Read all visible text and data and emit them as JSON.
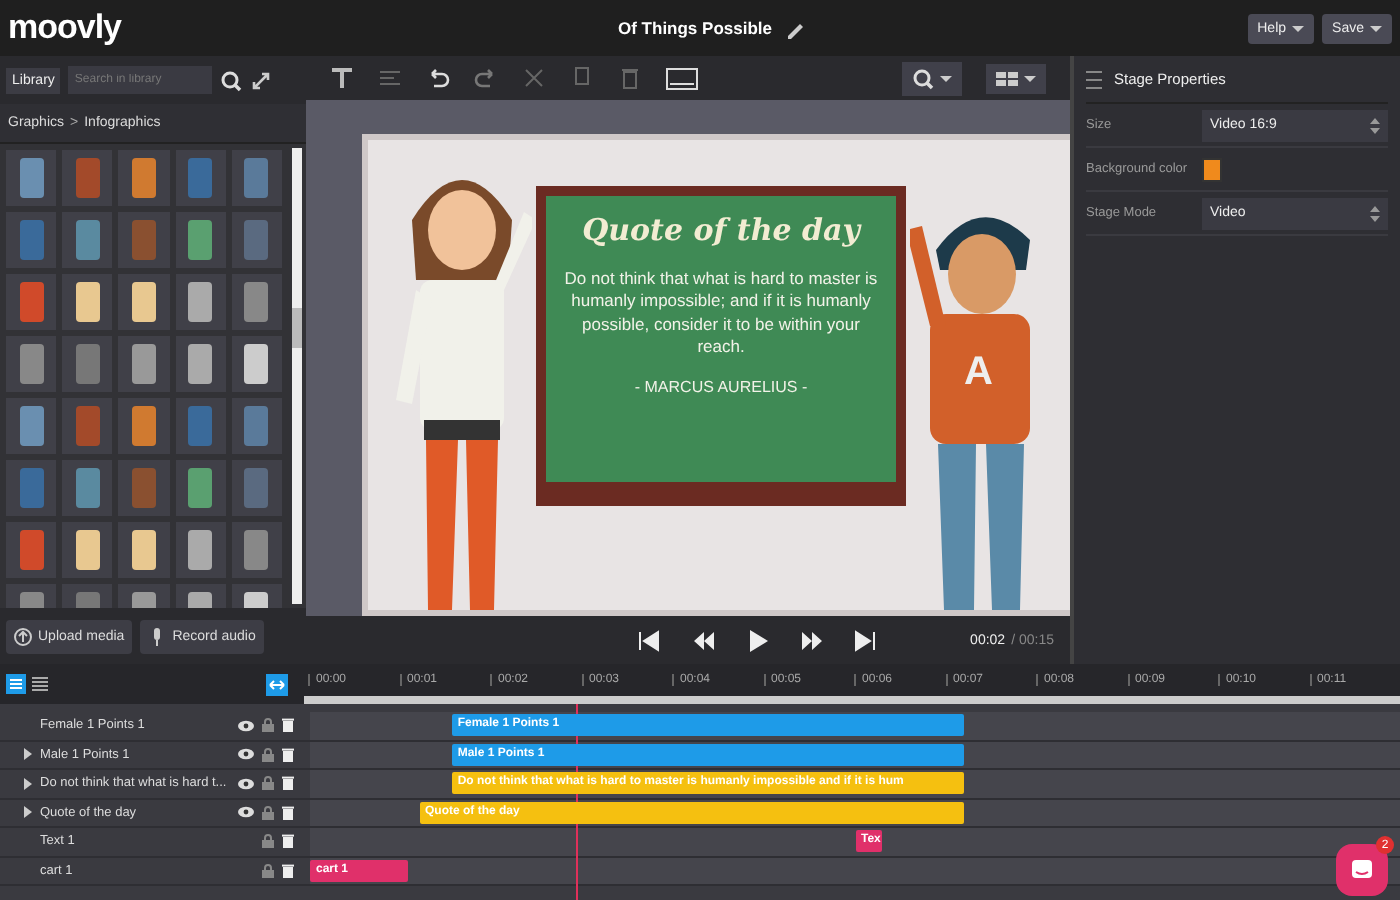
{
  "app": {
    "logo": "moovly",
    "title": "Of Things Possible",
    "buttons": [
      {
        "label": "Help"
      },
      {
        "label": "Save"
      }
    ]
  },
  "library": {
    "tab": "Library",
    "search": {
      "placeholder": "Search in library"
    },
    "breadcrumb": {
      "items": [
        "Graphics",
        "Infographics"
      ],
      "separator": ">"
    }
  },
  "properties": {
    "title": "Stage Properties",
    "fields": [
      {
        "kind": "select",
        "label": "Size",
        "value": "Video 16:9"
      },
      {
        "kind": "color",
        "label": "Background color",
        "color": "#f08a1c"
      },
      {
        "kind": "select",
        "label": "Stage Mode",
        "value": "Video"
      }
    ]
  },
  "stage": {
    "heading": "Quote of the day",
    "quote": "Do not think that what is hard to master is humanly impossible; and if it is humanly possible, consider it to be within your reach.",
    "author": "- MARCUS AURELIUS -",
    "shirt_letter": "A"
  },
  "media_buttons": [
    {
      "label": "Upload media"
    },
    {
      "label": "Record audio"
    }
  ],
  "player": {
    "time": "00:02",
    "duration": "/ 00:15"
  },
  "timeline": {
    "ruler": [
      "00:00",
      "00:01",
      "00:02",
      "00:03",
      "00:04",
      "00:05",
      "00:06",
      "00:07",
      "00:08",
      "00:09",
      "00:10",
      "00:11"
    ],
    "layers": [
      {
        "name": "Female 1 Points 1",
        "expandable": false,
        "visible_toggle": true,
        "clip": {
          "label": "Female 1 Points 1",
          "color": "#1e9be8"
        }
      },
      {
        "name": "Male 1 Points 1",
        "expandable": true,
        "visible_toggle": true,
        "clip": {
          "label": "Male 1 Points 1",
          "color": "#1e9be8"
        }
      },
      {
        "name": "Do not think that what is hard t...",
        "expandable": true,
        "visible_toggle": true,
        "clip": {
          "label": "Do not think that what is hard to master is humanly impossible and if it is hum",
          "color": "#f5c010"
        }
      },
      {
        "name": "Quote of the day",
        "expandable": true,
        "visible_toggle": true,
        "clip": {
          "label": "Quote of the day",
          "color": "#f5c010"
        }
      },
      {
        "name": "Text 1",
        "expandable": false,
        "visible_toggle": false,
        "clip": {
          "label": "Tex",
          "color": "#e0306a"
        }
      },
      {
        "name": "cart 1",
        "expandable": false,
        "visible_toggle": false,
        "clip": {
          "label": "cart 1",
          "color": "#e0306a"
        }
      }
    ]
  },
  "chat": {
    "badge": "2"
  }
}
